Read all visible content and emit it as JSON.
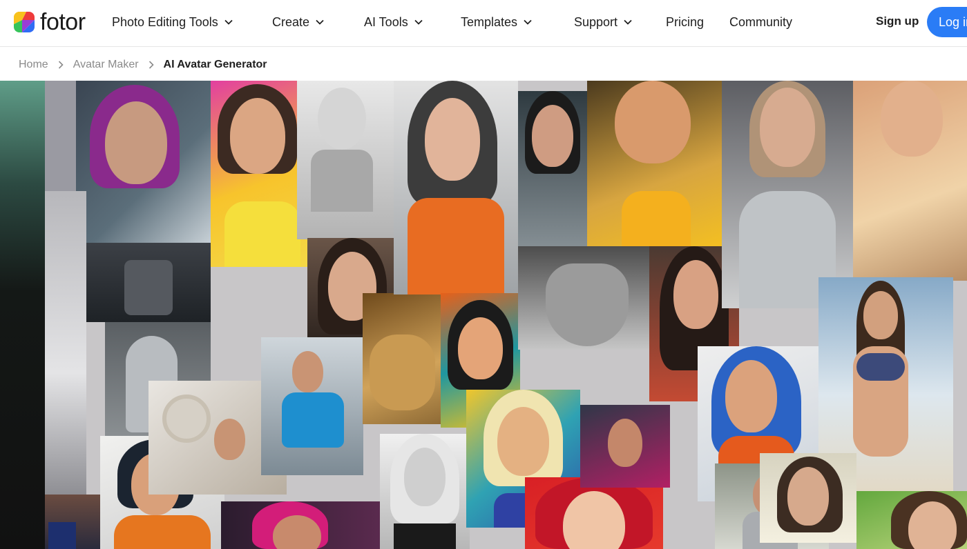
{
  "brand": {
    "name": "fotor",
    "logo_colors": [
      "#f8c21c",
      "#ee3b3b",
      "#2f6cf5",
      "#36c45a"
    ]
  },
  "nav": {
    "items": [
      {
        "label": "Photo Editing Tools",
        "has_dropdown": true
      },
      {
        "label": "Create",
        "has_dropdown": true
      },
      {
        "label": "AI Tools",
        "has_dropdown": true
      },
      {
        "label": "Templates",
        "has_dropdown": true
      },
      {
        "label": "Support",
        "has_dropdown": true
      },
      {
        "label": "Pricing",
        "has_dropdown": false
      },
      {
        "label": "Community",
        "has_dropdown": false
      }
    ],
    "signup_label": "Sign up",
    "login_label": "Log in"
  },
  "breadcrumb": {
    "items": [
      "Home",
      "Avatar Maker"
    ],
    "current": "AI Avatar Generator"
  },
  "hero": {
    "description": "",
    "accent_colors": [
      "#f2d21c",
      "#e5281e",
      "#2c69c9",
      "#e7722a"
    ]
  }
}
